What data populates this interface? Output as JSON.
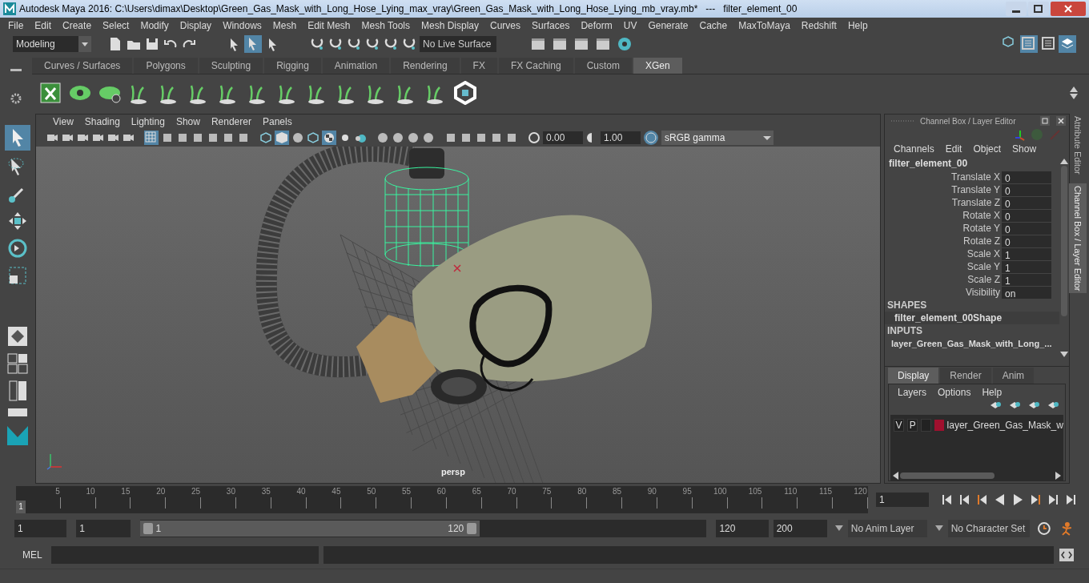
{
  "window": {
    "title": "Autodesk Maya 2016: C:\\Users\\dimax\\Desktop\\Green_Gas_Mask_with_Long_Hose_Lying_max_vray\\Green_Gas_Mask_with_Long_Hose_Lying_mb_vray.mb*   ---   filter_element_00"
  },
  "menus": [
    "File",
    "Edit",
    "Create",
    "Select",
    "Modify",
    "Display",
    "Windows",
    "Mesh",
    "Edit Mesh",
    "Mesh Tools",
    "Mesh Display",
    "Curves",
    "Surfaces",
    "Deform",
    "UV",
    "Generate",
    "Cache",
    "MaxToMaya",
    "Redshift",
    "Help"
  ],
  "toolbar": {
    "workspace": "Modeling",
    "live_surface": "No Live Surface"
  },
  "shelf_tabs": [
    {
      "label": "Curves / Surfaces",
      "selected": false
    },
    {
      "label": "Polygons",
      "selected": false
    },
    {
      "label": "Sculpting",
      "selected": false
    },
    {
      "label": "Rigging",
      "selected": false
    },
    {
      "label": "Animation",
      "selected": false
    },
    {
      "label": "Rendering",
      "selected": false
    },
    {
      "label": "FX",
      "selected": false
    },
    {
      "label": "FX Caching",
      "selected": false
    },
    {
      "label": "Custom",
      "selected": false
    },
    {
      "label": "XGen",
      "selected": true
    }
  ],
  "viewport": {
    "menus": [
      "View",
      "Shading",
      "Lighting",
      "Show",
      "Renderer",
      "Panels"
    ],
    "exposure": "0.00",
    "gamma": "1.00",
    "color_space": "sRGB gamma",
    "camera": "persp"
  },
  "channel_box": {
    "title": "Channel Box / Layer Editor",
    "menus": [
      "Channels",
      "Edit",
      "Object",
      "Show"
    ],
    "object": "filter_element_00",
    "channels": [
      {
        "name": "Translate X",
        "value": "0"
      },
      {
        "name": "Translate Y",
        "value": "0"
      },
      {
        "name": "Translate Z",
        "value": "0"
      },
      {
        "name": "Rotate X",
        "value": "0"
      },
      {
        "name": "Rotate Y",
        "value": "0"
      },
      {
        "name": "Rotate Z",
        "value": "0"
      },
      {
        "name": "Scale X",
        "value": "1"
      },
      {
        "name": "Scale Y",
        "value": "1"
      },
      {
        "name": "Scale Z",
        "value": "1"
      },
      {
        "name": "Visibility",
        "value": "on"
      }
    ],
    "shapes_header": "SHAPES",
    "shape": "filter_element_00Shape",
    "inputs_header": "INPUTS",
    "input": "layer_Green_Gas_Mask_with_Long_..."
  },
  "layer_editor": {
    "tabs": [
      {
        "label": "Display",
        "selected": true
      },
      {
        "label": "Render",
        "selected": false
      },
      {
        "label": "Anim",
        "selected": false
      }
    ],
    "menus": [
      "Layers",
      "Options",
      "Help"
    ],
    "layers": [
      {
        "visible": "V",
        "playback": "P",
        "color": "#a0102e",
        "name": "layer_Green_Gas_Mask_w"
      }
    ]
  },
  "side_tabs": [
    {
      "label": "Attribute Editor",
      "selected": false
    },
    {
      "label": "Channel Box / Layer Editor",
      "selected": true
    }
  ],
  "timeline": {
    "current": "1",
    "level": 0,
    "ticks": [
      "5",
      "10",
      "15",
      "20",
      "25",
      "30",
      "35",
      "40",
      "45",
      "50",
      "55",
      "60",
      "65",
      "70",
      "75",
      "80",
      "85",
      "90",
      "95",
      "100",
      "105",
      "110",
      "115",
      "120"
    ],
    "frame": "1"
  },
  "range": {
    "start": "1",
    "level": 0.6,
    "playback_start": "1",
    "slider_start": "1",
    "slider_end": "120",
    "playback_end": "120",
    "end": "200",
    "anim_layer": "No Anim Layer",
    "character_set": "No Character Set"
  },
  "command_line": {
    "label": "MEL"
  }
}
